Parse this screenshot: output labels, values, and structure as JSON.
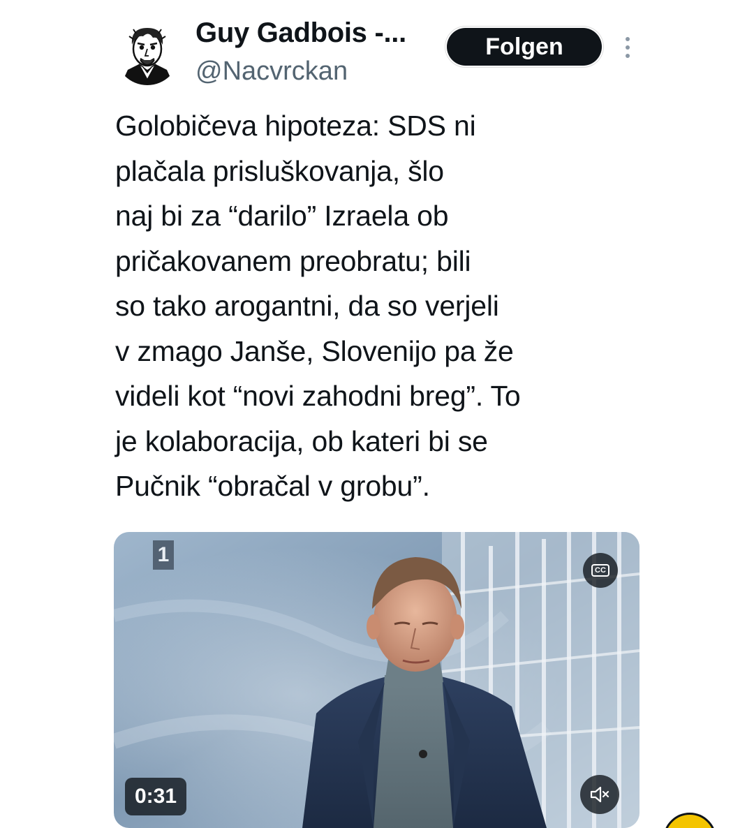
{
  "tweet": {
    "author_name": "Guy Gadbois -...",
    "author_handle": "@Nacvrckan",
    "follow_label": "Folgen",
    "more_icon": "more-vertical-icon",
    "text_lines": [
      "Golobičeva hipoteza: SDS ni",
      "plačala prisluškovanja, šlo",
      "naj bi za “darilo” Izraela ob",
      "pričakovanem preobratu; bili",
      "so tako arogantni, da so verjeli",
      "v zmago Janše, Slovenijo pa že",
      "videli kot “novi zahodni breg”. To",
      "je kolaboracija, ob kateri bi se",
      "Pučnik “obračal v grobu”."
    ]
  },
  "video": {
    "channel_number": "1",
    "cc_label": "CC",
    "duration": "0:31",
    "mute_icon": "speaker-muted-icon",
    "cc_icon": "closed-captions-icon"
  },
  "colors": {
    "text": "#0f1419",
    "secondary_text": "#536471",
    "button_bg": "#0f1419",
    "button_text": "#ffffff",
    "overlay": "#0f1419"
  }
}
